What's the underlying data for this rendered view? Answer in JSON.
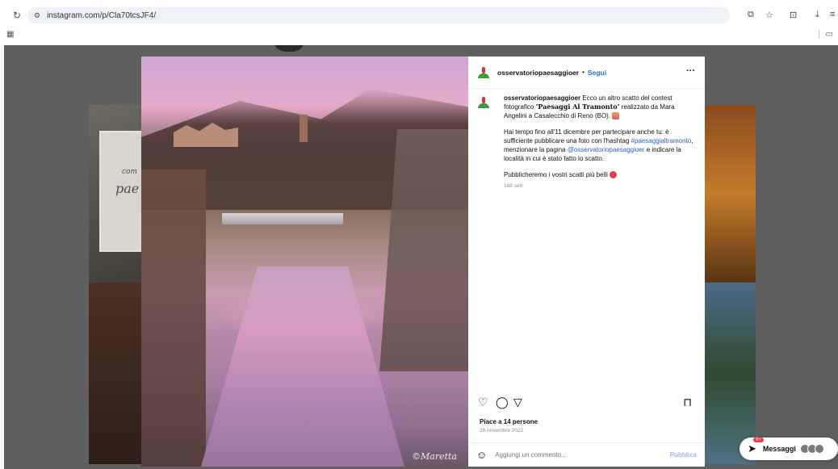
{
  "browser": {
    "url": "instagram.com/p/Cla70tcsJF4/",
    "reload_icon": "reload-icon",
    "site_settings_icon": "site-settings-icon"
  },
  "post": {
    "username": "osservatoriopaesaggioer",
    "separator": "•",
    "follow_label": "Segui",
    "more_label": "···",
    "caption": {
      "username": "osservatoriopaesaggioer",
      "line1_a": " Ecco un altro scatto del contest fotografico \"",
      "line1_bold": "Paesaggi Al Tramonto",
      "line1_b": "\" realizzato da Mara Angelini a Casalecchio di Reno (BO).",
      "para2_a": "Hai tempo fino all'11 dicembre per partecipare anche tu: è sufficiente pubblicare una foto con l'hashtag ",
      "hashtag": "#paesaggialtramonto",
      "para2_b": ", menzionare la pagina ",
      "mention": "@osservatoriopaesaggioer",
      "para2_c": " e indicare la località in cui è stato fatto lo scatto.",
      "para3": "Pubblicheremo i vostri scatti più belli",
      "time": "168 sett"
    },
    "likes": "Piace a 14 persone",
    "date": "26 novembre 2022",
    "comment_placeholder": "Aggiungi un commento...",
    "post_label": "Pubblica",
    "watermark": "©Maretta"
  },
  "background_card": {
    "text1": "com",
    "text2": "pae"
  },
  "messages": {
    "label": "Messaggi",
    "badge": "9+"
  },
  "colors": {
    "link": "#2e5dc8",
    "follow": "#1b74e4",
    "overlay": "#5f5f5f"
  }
}
